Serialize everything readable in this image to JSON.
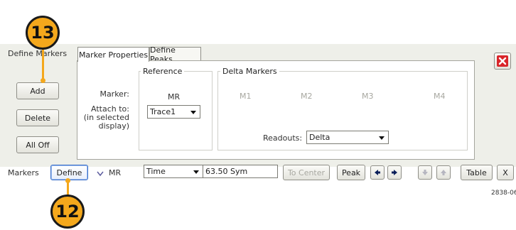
{
  "callouts": {
    "top": "13",
    "bottom": "12"
  },
  "sidebar": {
    "title": "Define Markers",
    "add": "Add",
    "delete": "Delete",
    "all_off": "All Off"
  },
  "tabs": [
    "Marker Properties",
    "Define Peaks"
  ],
  "reference": {
    "group_title": "Reference",
    "marker_label": "Marker:",
    "marker_value": "MR",
    "attach_label_1": "Attach to:",
    "attach_label_2": "(in selected",
    "attach_label_3": "display)",
    "attach_value": "Trace1"
  },
  "delta": {
    "group_title": "Delta Markers",
    "markers": [
      "M1",
      "M2",
      "M3",
      "M4"
    ],
    "readouts_label": "Readouts:",
    "readouts_value": "Delta"
  },
  "close_icon": "close-icon",
  "toolbar": {
    "markers_label": "Markers",
    "define": "Define",
    "marker_sel": "MR",
    "mode_value": "Time",
    "value": "63.50 Sym",
    "to_center": "To Center",
    "peak": "Peak",
    "table": "Table",
    "x": "X"
  },
  "figure_id": "2838-06"
}
